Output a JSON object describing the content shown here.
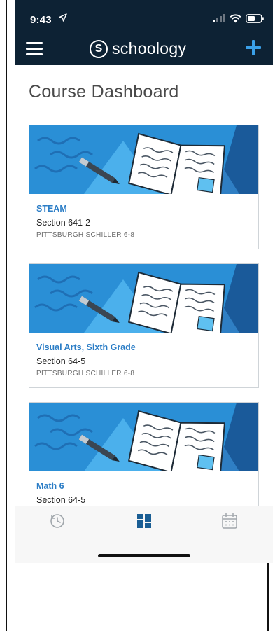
{
  "status_bar": {
    "time": "9:43"
  },
  "header": {
    "logo_mark": "S",
    "logo_text": "schoology"
  },
  "page": {
    "title": "Course Dashboard"
  },
  "courses": [
    {
      "name": "STEAM",
      "section": "Section 641-2",
      "school": "PITTSBURGH SCHILLER 6-8"
    },
    {
      "name": "Visual Arts, Sixth Grade",
      "section": "Section 64-5",
      "school": "PITTSBURGH SCHILLER 6-8"
    },
    {
      "name": "Math 6",
      "section": "Section 64-5",
      "school": ""
    }
  ],
  "tabs": [
    {
      "icon": "recent-activity-icon",
      "active": false
    },
    {
      "icon": "course-dashboard-icon",
      "active": true
    },
    {
      "icon": "calendar-icon",
      "active": false
    }
  ],
  "colors": {
    "header_bg": "#0d2234",
    "accent": "#2b7dc6",
    "card_art_bg": "#2a8fd6",
    "tab_active": "#1a5e94",
    "tab_inactive": "#a0a6ab"
  }
}
